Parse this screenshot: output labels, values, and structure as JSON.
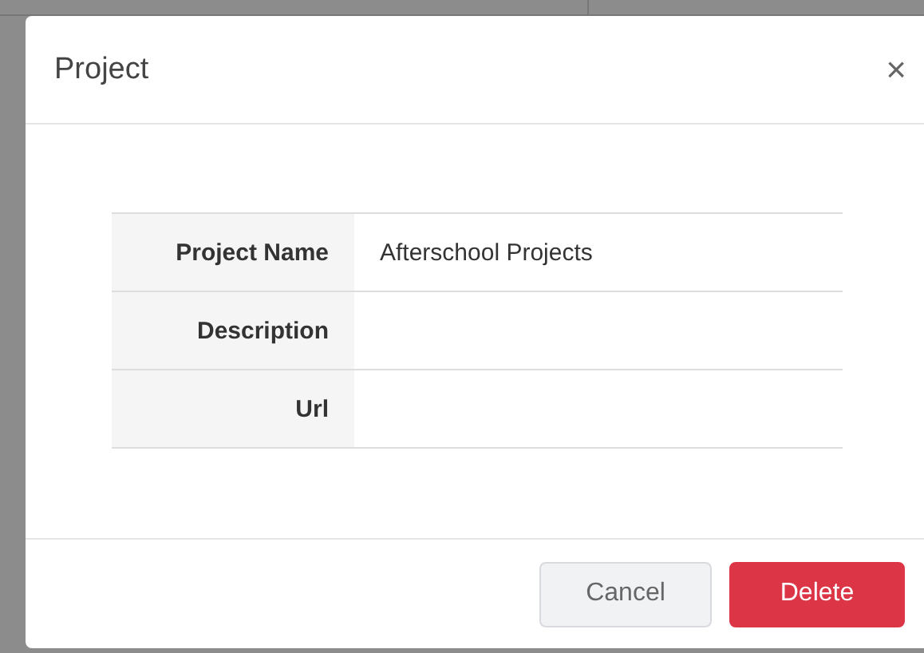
{
  "dialog": {
    "title": "Project",
    "close": "×",
    "fields": [
      {
        "label": "Project Name",
        "value": "Afterschool Projects"
      },
      {
        "label": "Description"
      },
      {
        "label": "Url"
      }
    ],
    "buttons": [
      {
        "label": "Cancel",
        "kind": "secondary"
      },
      {
        "label": "Delete",
        "kind": "danger"
      }
    ]
  }
}
